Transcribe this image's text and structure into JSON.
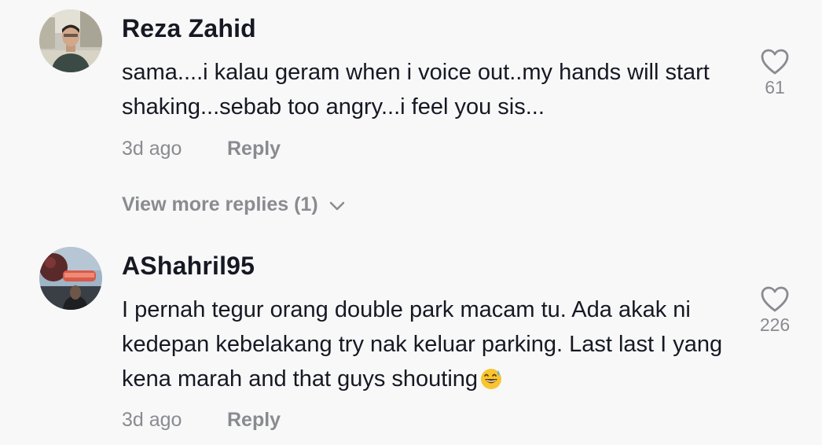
{
  "comments": [
    {
      "username": "Reza Zahid",
      "text": "sama....i kalau geram when i voice out..my hands will start shaking...sebab too angry...i feel you sis...",
      "time": "3d ago",
      "reply_label": "Reply",
      "likes": "61",
      "avatar_icon": "user-avatar-photo"
    },
    {
      "username": "AShahril95",
      "text": "I pernah tegur orang double park macam tu. Ada akak ni kedepan kebelakang try nak keluar parking. Last last I yang kena marah and that guys shouting",
      "emoji": "grinning-sweat-emoji",
      "time": "3d ago",
      "reply_label": "Reply",
      "likes": "226",
      "avatar_icon": "user-avatar-photo"
    }
  ],
  "view_more": {
    "label": "View more replies (1)",
    "icon": "chevron-down-icon"
  },
  "colors": {
    "background": "#f8f8f8",
    "primary_text": "#161823",
    "secondary_text": "#8a8b91"
  }
}
